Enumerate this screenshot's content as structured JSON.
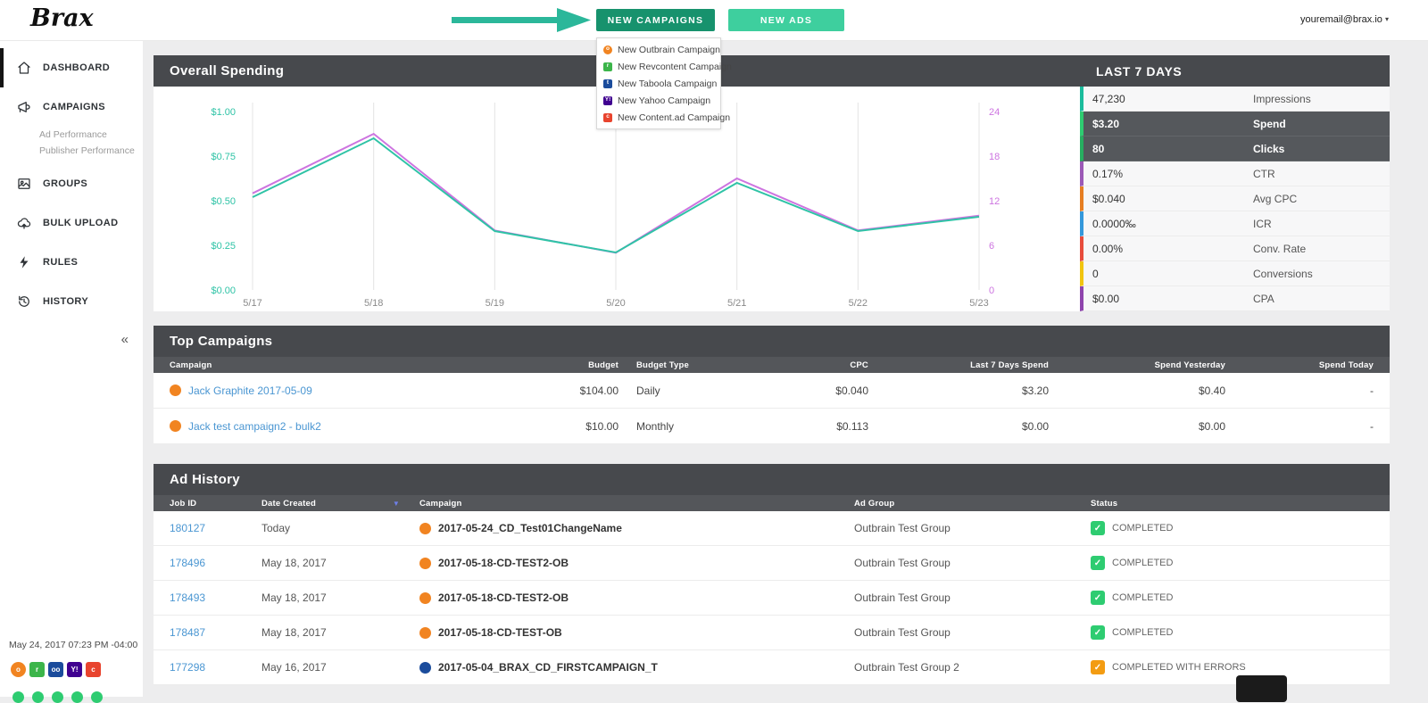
{
  "topbar": {
    "logo": "Brax",
    "new_campaigns_label": "NEW CAMPAIGNS",
    "new_ads_label": "NEW ADS",
    "user_email": "youremail@brax.io",
    "accent_colors": {
      "new_campaigns_bg": "#17926d",
      "new_ads_bg": "#3ecf9e",
      "arrow": "#2bb79a"
    },
    "dropdown_items": [
      {
        "label": "New Outbrain Campaign",
        "network": "outbrain",
        "color": "#f18421",
        "glyph": "o"
      },
      {
        "label": "New Revcontent Campaign",
        "network": "revcontent",
        "color": "#3cb54a",
        "glyph": "r"
      },
      {
        "label": "New Taboola Campaign",
        "network": "taboola",
        "color": "#1b4c9c",
        "glyph": "t"
      },
      {
        "label": "New Yahoo Campaign",
        "network": "yahoo",
        "color": "#400090",
        "glyph": "Y!"
      },
      {
        "label": "New Content.ad Campaign",
        "network": "contentad",
        "color": "#e8442e",
        "glyph": "c"
      }
    ]
  },
  "sidebar": {
    "items": [
      {
        "label": "DASHBOARD",
        "icon": "home-icon",
        "active": true
      },
      {
        "label": "CAMPAIGNS",
        "icon": "megaphone-icon",
        "active": false,
        "children": [
          "Ad Performance",
          "Publisher Performance"
        ]
      },
      {
        "label": "GROUPS",
        "icon": "groups-icon",
        "active": false
      },
      {
        "label": "BULK UPLOAD",
        "icon": "cloud-upload-icon",
        "active": false
      },
      {
        "label": "RULES",
        "icon": "lightning-icon",
        "active": false
      },
      {
        "label": "HISTORY",
        "icon": "history-icon",
        "active": false
      }
    ],
    "collapse_glyph": "«",
    "timestamp": "May 24, 2017 07:23 PM -04:00",
    "networks": [
      {
        "name": "outbrain",
        "color": "#f18421",
        "glyph": "o"
      },
      {
        "name": "revcontent",
        "color": "#3cb54a",
        "glyph": "r"
      },
      {
        "name": "taboola",
        "color": "#1b4c9c",
        "glyph": "oo"
      },
      {
        "name": "yahoo",
        "color": "#400090",
        "glyph": "Y!"
      },
      {
        "name": "contentad",
        "color": "#e8442e",
        "glyph": "c"
      }
    ]
  },
  "spending_panel": {
    "title": "Overall Spending",
    "last7days": {
      "title": "LAST 7 DAYS",
      "stats": [
        {
          "value": "47,230",
          "label": "Impressions",
          "color": "#1abc9c",
          "highlight": false
        },
        {
          "value": "$3.20",
          "label": "Spend",
          "color": "#2ecc71",
          "highlight": true
        },
        {
          "value": "80",
          "label": "Clicks",
          "color": "#27ae60",
          "highlight": true
        },
        {
          "value": "0.17%",
          "label": "CTR",
          "color": "#9b59b6",
          "highlight": false
        },
        {
          "value": "$0.040",
          "label": "Avg CPC",
          "color": "#e67e22",
          "highlight": false
        },
        {
          "value": "0.0000‰",
          "label": "ICR",
          "color": "#3498db",
          "highlight": false
        },
        {
          "value": "0.00%",
          "label": "Conv. Rate",
          "color": "#e74c3c",
          "highlight": false
        },
        {
          "value": "0",
          "label": "Conversions",
          "color": "#f1c40f",
          "highlight": false
        },
        {
          "value": "$0.00",
          "label": "CPA",
          "color": "#8e44ad",
          "highlight": false
        }
      ]
    }
  },
  "chart_data": {
    "type": "line",
    "title": "Overall Spending",
    "x": [
      "5/17",
      "5/18",
      "5/19",
      "5/20",
      "5/21",
      "5/22",
      "5/23"
    ],
    "series": [
      {
        "name": "Spend",
        "axis": "left",
        "color": "#2fc3a6",
        "axis_max": 1.0,
        "values": [
          0.52,
          0.85,
          0.33,
          0.21,
          0.6,
          0.33,
          0.41
        ]
      },
      {
        "name": "Clicks",
        "axis": "right",
        "color": "#cd74e0",
        "axis_max": 24,
        "values": [
          13,
          21,
          8,
          5,
          15,
          8,
          10
        ]
      }
    ],
    "left_ticks": [
      "$0.00",
      "$0.25",
      "$0.50",
      "$0.75",
      "$1.00"
    ],
    "right_ticks": [
      "0",
      "6",
      "12",
      "18",
      "24"
    ],
    "left_axis_range": [
      0,
      1
    ],
    "right_axis_range": [
      0,
      24
    ],
    "grid": "vertical",
    "legend": "none"
  },
  "top_campaigns": {
    "title": "Top Campaigns",
    "columns": [
      "Campaign",
      "Budget",
      "Budget Type",
      "CPC",
      "Last 7 Days Spend",
      "Spend Yesterday",
      "Spend Today"
    ],
    "rows": [
      {
        "campaign": "Jack Graphite 2017-05-09",
        "network": "outbrain",
        "network_color": "#f18421",
        "budget": "$104.00",
        "budget_type": "Daily",
        "cpc": "$0.040",
        "last_7_days_spend": "$3.20",
        "spend_yesterday": "$0.40",
        "spend_today": "-"
      },
      {
        "campaign": "Jack test campaign2 - bulk2",
        "network": "outbrain",
        "network_color": "#f18421",
        "budget": "$10.00",
        "budget_type": "Monthly",
        "cpc": "$0.113",
        "last_7_days_spend": "$0.00",
        "spend_yesterday": "$0.00",
        "spend_today": "-"
      }
    ]
  },
  "ad_history": {
    "title": "Ad History",
    "columns": [
      "Job ID",
      "Date Created",
      "Campaign",
      "Ad Group",
      "Status"
    ],
    "sorted_column": "Date Created",
    "rows": [
      {
        "job_id": "180127",
        "date_created": "Today",
        "campaign": "2017-05-24_CD_Test01ChangeName",
        "network": "outbrain",
        "network_color": "#f18421",
        "ad_group": "Outbrain Test Group",
        "status": "COMPLETED",
        "status_color": "#2ecc71"
      },
      {
        "job_id": "178496",
        "date_created": "May 18, 2017",
        "campaign": "2017-05-18-CD-TEST2-OB",
        "network": "outbrain",
        "network_color": "#f18421",
        "ad_group": "Outbrain Test Group",
        "status": "COMPLETED",
        "status_color": "#2ecc71"
      },
      {
        "job_id": "178493",
        "date_created": "May 18, 2017",
        "campaign": "2017-05-18-CD-TEST2-OB",
        "network": "outbrain",
        "network_color": "#f18421",
        "ad_group": "Outbrain Test Group",
        "status": "COMPLETED",
        "status_color": "#2ecc71"
      },
      {
        "job_id": "178487",
        "date_created": "May 18, 2017",
        "campaign": "2017-05-18-CD-TEST-OB",
        "network": "outbrain",
        "network_color": "#f18421",
        "ad_group": "Outbrain Test Group",
        "status": "COMPLETED",
        "status_color": "#2ecc71"
      },
      {
        "job_id": "177298",
        "date_created": "May 16, 2017",
        "campaign": "2017-05-04_BRAX_CD_FIRSTCAMPAIGN_T",
        "network": "taboola",
        "network_color": "#1b4c9c",
        "ad_group": "Outbrain Test Group 2",
        "status": "COMPLETED WITH ERRORS",
        "status_color": "#f39c12"
      }
    ]
  }
}
